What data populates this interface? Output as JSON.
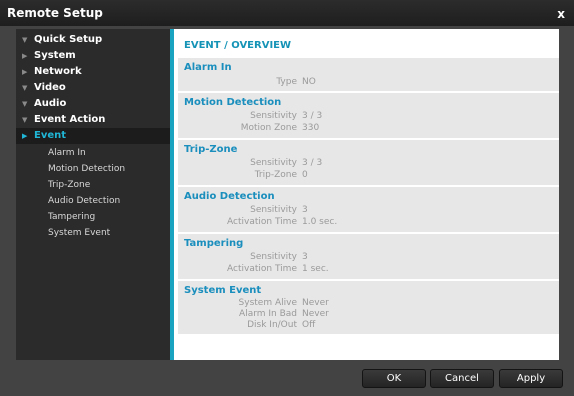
{
  "window": {
    "title": "Remote Setup",
    "close_label": "x"
  },
  "tree": {
    "items": [
      {
        "label": "Quick Setup",
        "arrow": "▼"
      },
      {
        "label": "System",
        "arrow": "▶"
      },
      {
        "label": "Network",
        "arrow": "▶"
      },
      {
        "label": "Video",
        "arrow": "▼"
      },
      {
        "label": "Audio",
        "arrow": "▼"
      },
      {
        "label": "Event Action",
        "arrow": "▼"
      },
      {
        "label": "Event",
        "arrow": "▶",
        "selected": true
      }
    ],
    "subitems": [
      "Alarm In",
      "Motion Detection",
      "Trip-Zone",
      "Audio Detection",
      "Tampering",
      "System Event"
    ]
  },
  "content": {
    "title": "EVENT / OVERVIEW",
    "sections": [
      {
        "title": "Alarm In",
        "rows": [
          {
            "key": "Type",
            "value": "NO"
          }
        ]
      },
      {
        "title": "Motion Detection",
        "rows": [
          {
            "key": "Sensitivity",
            "value": "3 / 3"
          },
          {
            "key": "Motion Zone",
            "value": "330"
          }
        ]
      },
      {
        "title": "Trip-Zone",
        "rows": [
          {
            "key": "Sensitivity",
            "value": "3 / 3"
          },
          {
            "key": "Trip-Zone",
            "value": "0"
          }
        ]
      },
      {
        "title": "Audio Detection",
        "rows": [
          {
            "key": "Sensitivity",
            "value": "3"
          },
          {
            "key": "Activation Time",
            "value": "1.0 sec."
          }
        ]
      },
      {
        "title": "Tampering",
        "rows": [
          {
            "key": "Sensitivity",
            "value": "3"
          },
          {
            "key": "Activation Time",
            "value": "1 sec."
          }
        ]
      },
      {
        "title": "System Event",
        "rows": [
          {
            "key": "System Alive",
            "value": "Never"
          },
          {
            "key": "Alarm In Bad",
            "value": "Never"
          },
          {
            "key": "Disk In/Out",
            "value": "Off"
          }
        ]
      }
    ]
  },
  "buttons": {
    "ok": "OK",
    "cancel": "Cancel",
    "apply": "Apply"
  },
  "colors": {
    "accent": "#1aa3c0",
    "selected_text": "#20b6d6",
    "section_title": "#1a8ebd"
  }
}
